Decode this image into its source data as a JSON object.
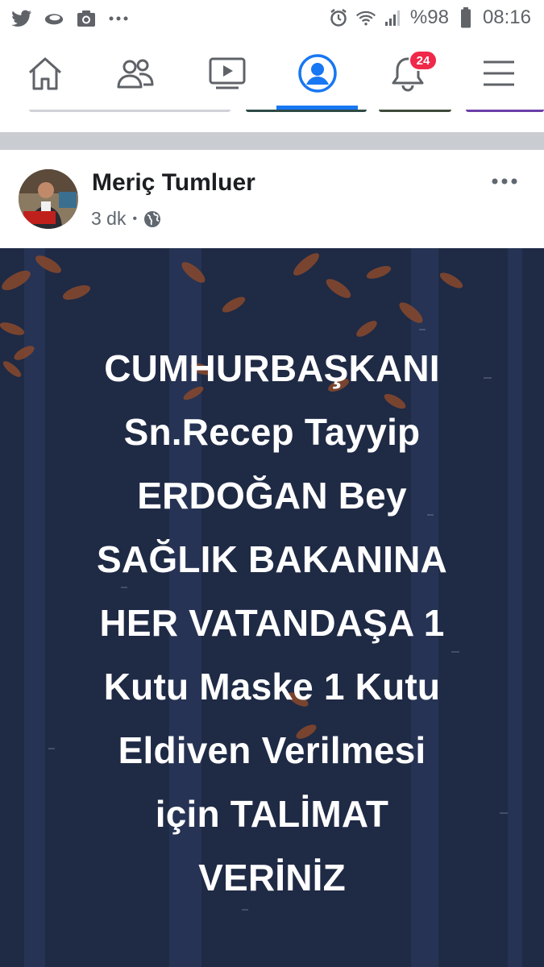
{
  "status_bar": {
    "left_icons": [
      "twitter-icon",
      "cloud-icon",
      "camera-icon",
      "more-dots-icon"
    ],
    "battery": "%98",
    "time": "08:16"
  },
  "nav": {
    "items": [
      "home-icon",
      "friends-icon",
      "video-icon",
      "profile-icon",
      "notifications-icon",
      "menu-icon"
    ],
    "active": "profile-icon",
    "notification_count": "24",
    "accent_color": "#1877f2",
    "badge_color": "#f02849"
  },
  "post": {
    "author": "Meriç Tumluer",
    "time": "3 dk",
    "separator": "•",
    "privacy": "globe-icon",
    "background_color": "#1f2a45",
    "text_lines": [
      "CUMHURBAŞKANI",
      "Sn.Recep Tayyip",
      "ERDOĞAN Bey",
      "SAĞLIK BAKANINA",
      "HER VATANDAŞA 1",
      "Kutu Maske 1 Kutu",
      "Eldiven Verilmesi",
      "için TALİMAT",
      "VERİNİZ"
    ]
  }
}
